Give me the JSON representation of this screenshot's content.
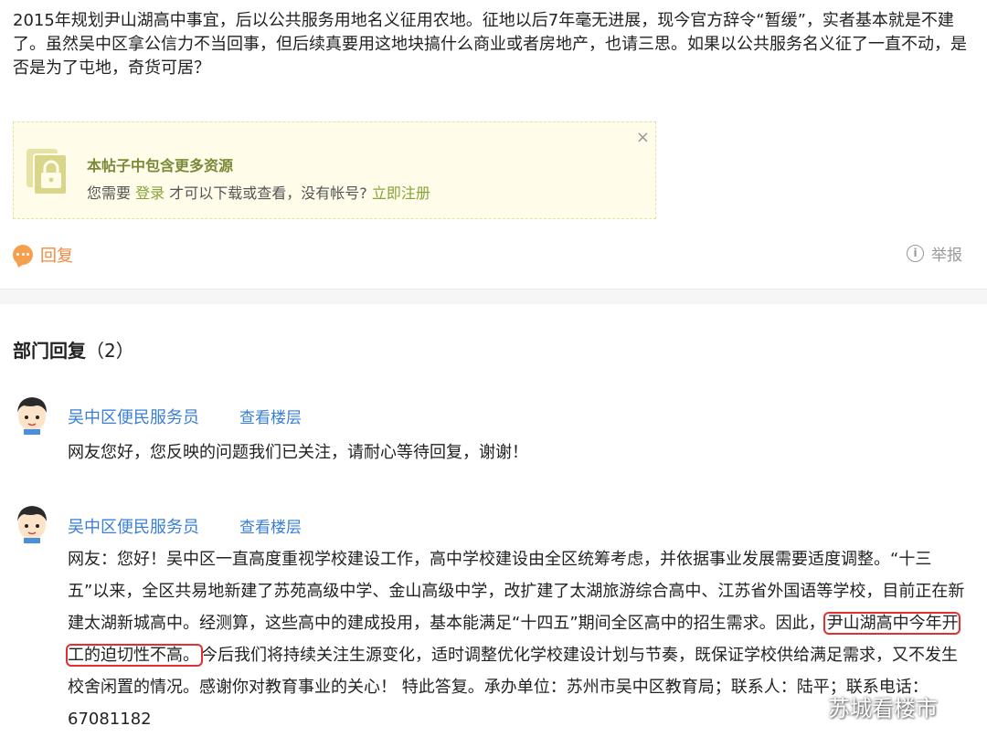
{
  "post": {
    "body": "2015年规划尹山湖高中事宜，后以公共服务用地名义征用农地。征地以后7年毫无进展，现今官方辞令“暂缓”，实者基本就是不建了。虽然吴中区拿公信力不当回事，但后续真要用这地块搞什么商业或者房地产，也请三思。如果以公共服务名义征了一直不动，是否是为了屯地，奇货可居？"
  },
  "resource_notice": {
    "title": "本帖子中包含更多资源",
    "prefix": "您需要",
    "login_link": "登录",
    "middle": "才可以下载或查看，没有帐号?",
    "register_link": "立即注册",
    "close_glyph": "×",
    "icon": "lock-document-icon"
  },
  "actions": {
    "reply_label": "回复",
    "report_label": "举报",
    "report_icon_glyph": "i"
  },
  "section": {
    "title": "部门回复",
    "count": "（2）"
  },
  "replies": [
    {
      "author": "吴中区便民服务员",
      "view_floor": "查看楼层",
      "text": "网友您好，您反映的问题我们已关注，请耐心等待回复，谢谢！"
    },
    {
      "author": "吴中区便民服务员",
      "view_floor": "查看楼层",
      "text_before": "网友：您好！吴中区一直高度重视学校建设工作，高中学校建设由全区统筹考虑，并依据事业发展需要适度调整。“十三五”以来，全区共易地新建了苏苑高级中学、金山高级中学，改扩建了太湖旅游综合高中、江苏省外国语等学校，目前正在新建太湖新城高中。经测算，这些高中的建成投用，基本能满足“十四五”期间全区高中的招生需求。因此，",
      "text_highlight": "尹山湖高中今年开工的迫切性不高。",
      "text_after": "今后我们将持续关注生源变化，适时调整优化学校建设计划与节奏，既保证学校供给满足需求，又不发生校舍闲置的情况。感谢你对教育事业的关心！ 特此答复。承办单位：苏州市吴中区教育局；联系人：陆平；联系电话：67081182"
    }
  ],
  "watermark": {
    "text": "苏城看楼市",
    "icon": "wechat-icon"
  },
  "colors": {
    "link_blue": "#3a7fd5",
    "link_green": "#86a33a",
    "reply_orange": "#f08a3d",
    "highlight_red": "#e03030",
    "notice_bg": "#fffde9"
  }
}
